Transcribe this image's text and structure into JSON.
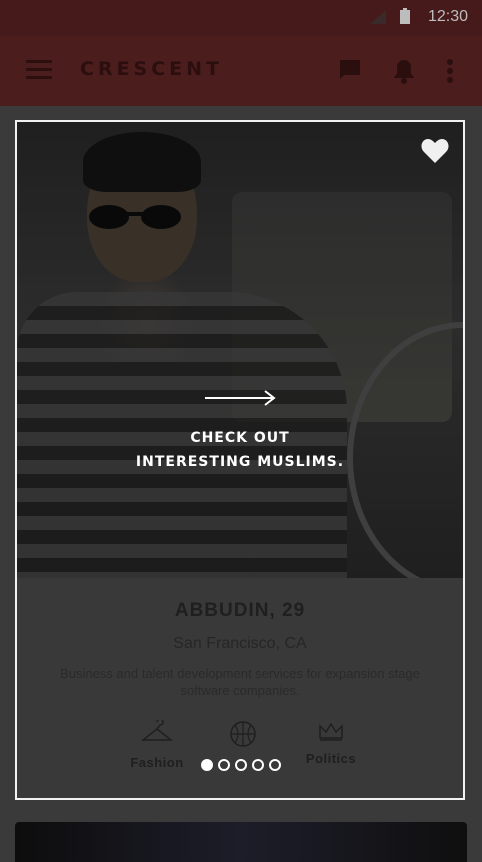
{
  "status_bar": {
    "time": "12:30",
    "icons": [
      "signal-icon",
      "battery-icon"
    ]
  },
  "app_bar": {
    "brand": "CRESCENT",
    "icons": [
      "menu-icon",
      "chat-icon",
      "bell-icon",
      "more-vert-icon"
    ]
  },
  "card": {
    "cta_line1": "CHECK OUT",
    "cta_line2": "INTERESTING MUSLIMS.",
    "name": "ABBUDIN, 29",
    "location": "San Francisco, CA",
    "description": "Business and talent development services for expansion stage software companies.",
    "interests": [
      {
        "label": "Fashion",
        "icon": "hanger-icon"
      },
      {
        "label": "",
        "icon": "basketball-icon"
      },
      {
        "label": "Politics",
        "icon": "crown-icon"
      }
    ],
    "pagination": {
      "total": 5,
      "active": 1
    }
  },
  "colors": {
    "app_bar": "#4c1d1d",
    "status_bar": "#461a1a",
    "card_border": "#f2f2f2",
    "background": "#3a3a3a"
  }
}
